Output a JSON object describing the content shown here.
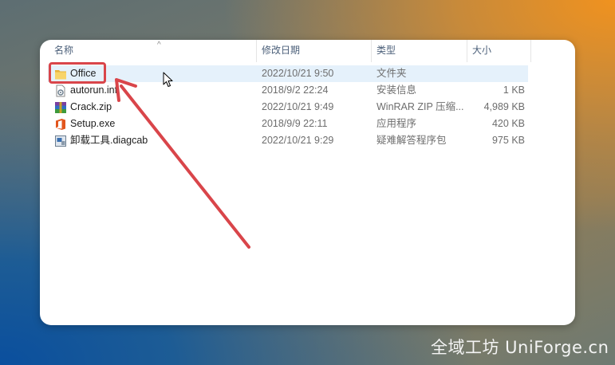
{
  "columns": {
    "name": "名称",
    "date": "修改日期",
    "type": "类型",
    "size": "大小"
  },
  "files": [
    {
      "name": "Office",
      "date": "2022/10/21 9:50",
      "type": "文件夹",
      "size": "",
      "icon": "folder-icon",
      "selected": true
    },
    {
      "name": "autorun.inf",
      "date": "2018/9/2 22:24",
      "type": "安装信息",
      "size": "1 KB",
      "icon": "settings-file-icon",
      "selected": false
    },
    {
      "name": "Crack.zip",
      "date": "2022/10/21 9:49",
      "type": "WinRAR ZIP 压缩...",
      "size": "4,989 KB",
      "icon": "winrar-archive-icon",
      "selected": false
    },
    {
      "name": "Setup.exe",
      "date": "2018/9/9 22:11",
      "type": "应用程序",
      "size": "420 KB",
      "icon": "office-setup-icon",
      "selected": false
    },
    {
      "name": "卸载工具.diagcab",
      "date": "2022/10/21 9:29",
      "type": "疑难解答程序包",
      "size": "975 KB",
      "icon": "diagcab-icon",
      "selected": false
    }
  ],
  "watermark": "全域工坊 UniForge.cn",
  "colors": {
    "highlight": "#d9454a",
    "selection": "#e5f1fb",
    "folder": "#f5c542"
  }
}
